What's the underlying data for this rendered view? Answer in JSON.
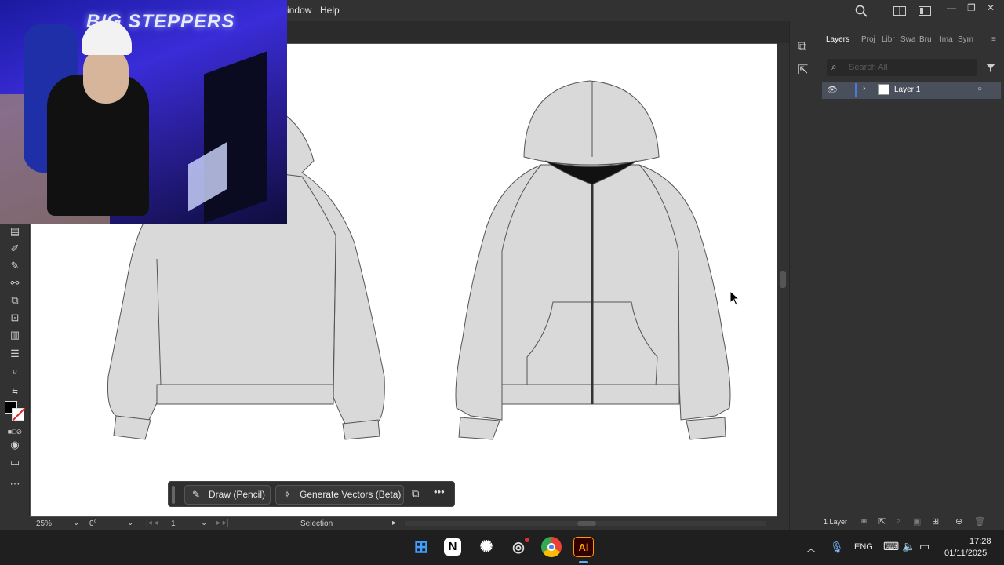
{
  "menubar": {
    "items": [
      "indow",
      "Help"
    ]
  },
  "webcam": {
    "overlay_text": "BIG STEPPERS"
  },
  "panel": {
    "tabs": [
      "Layers",
      "Proj",
      "Libr",
      "Swa",
      "Bru",
      "Ima",
      "Sym"
    ],
    "search_placeholder": "Search All",
    "layer_name": "Layer 1",
    "layer_count": "1 Layer"
  },
  "context_bar": {
    "draw_label": "Draw (Pencil)",
    "generate_label": "Generate Vectors (Beta)"
  },
  "statusbar": {
    "zoom": "25%",
    "rotation": "0°",
    "artboard": "1",
    "tool": "Selection"
  },
  "taskbar": {
    "language": "ENG",
    "time": "17:28",
    "date": "01/11/2025"
  },
  "colors": {
    "accent": "#4b7bd8",
    "fill": "#d9d9d9",
    "canvas": "#ffffff"
  }
}
